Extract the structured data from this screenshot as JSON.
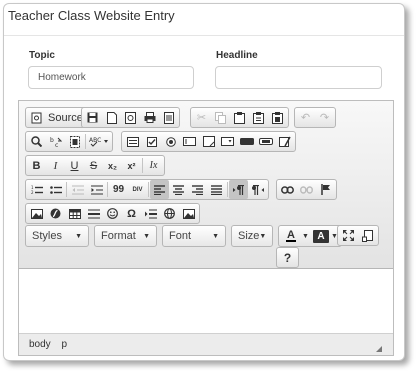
{
  "dialog": {
    "title": "Teacher Class Website Entry"
  },
  "form": {
    "topic_label": "Topic",
    "topic_value": "Homework",
    "headline_label": "Headline",
    "headline_value": ""
  },
  "toolbar": {
    "source_label": "Source",
    "icons": {
      "source": "source-icon",
      "save": "save-icon",
      "new_page": "new-page-icon",
      "preview": "preview-icon",
      "print": "print-icon",
      "templates": "templates-icon",
      "cut": "cut-icon",
      "copy": "copy-icon",
      "paste": "paste-icon",
      "paste_text": "paste-text-icon",
      "paste_word": "paste-word-icon",
      "undo": "undo-icon",
      "redo": "redo-icon"
    },
    "italic_label": "I",
    "underline_label": "U",
    "strike_label": "S",
    "bold_label": "B",
    "subscript_label": "x₂",
    "superscript_label": "x²",
    "remove_format_label": "Ix",
    "blockquote_label": "99",
    "creatediv_label": "DIV",
    "omega_label": "Ω",
    "help_label": "?",
    "combos": {
      "styles": "Styles",
      "format": "Format",
      "font": "Font",
      "size": "Size",
      "text_color": "A",
      "bg_color": "A"
    }
  },
  "statusbar": {
    "path": [
      "body",
      "p"
    ]
  },
  "colors": {
    "toolbar_bg": "#e8e8e8",
    "active_button": "#c4c4c4",
    "border": "#b6b6b6"
  }
}
